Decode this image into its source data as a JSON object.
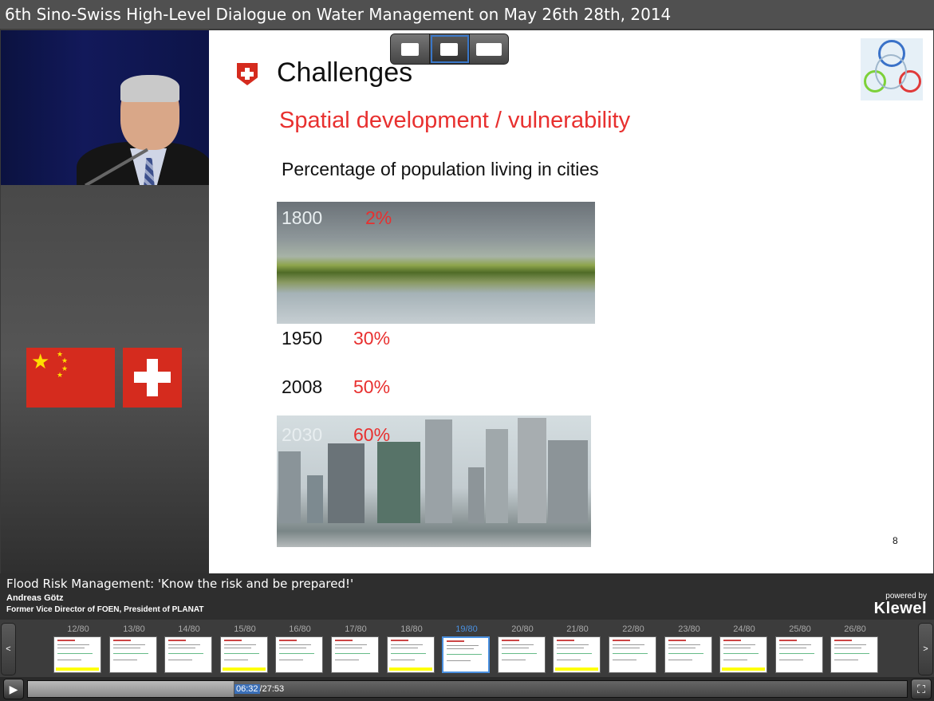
{
  "window": {
    "title": "6th Sino-Swiss High-Level Dialogue on Water Management on May 26th  28th, 2014"
  },
  "slide": {
    "title": "Challenges",
    "subtitle": "Spatial development / vulnerability",
    "heading": "Percentage of population living in cities",
    "rows": [
      {
        "year": "1800",
        "percent": "2%"
      },
      {
        "year": "1950",
        "percent": "30%"
      },
      {
        "year": "2008",
        "percent": "50%"
      },
      {
        "year": "2030",
        "percent": "60%"
      }
    ],
    "page_number": "8"
  },
  "talk": {
    "title": "Flood Risk Management: 'Know the risk and be prepared!'",
    "speaker": "Andreas Götz",
    "role": "Former Vice Director of FOEN, President of PLANAT"
  },
  "branding": {
    "powered_by": "powered by",
    "name": "Klewel"
  },
  "view_modes": [
    {
      "name": "video-only",
      "icon": "person-icon"
    },
    {
      "name": "slides-only",
      "icon": "slide-icon",
      "active": true
    },
    {
      "name": "video-and-slides",
      "icon": "person-slide-icon"
    }
  ],
  "thumbnails": {
    "prev_label": "<",
    "next_label": ">",
    "items": [
      {
        "label": "12/80"
      },
      {
        "label": "13/80"
      },
      {
        "label": "14/80"
      },
      {
        "label": "15/80"
      },
      {
        "label": "16/80"
      },
      {
        "label": "17/80"
      },
      {
        "label": "18/80"
      },
      {
        "label": "19/80",
        "current": true
      },
      {
        "label": "20/80"
      },
      {
        "label": "21/80"
      },
      {
        "label": "22/80"
      },
      {
        "label": "23/80"
      },
      {
        "label": "24/80"
      },
      {
        "label": "25/80"
      },
      {
        "label": "26/80"
      }
    ]
  },
  "player": {
    "current_time": "06:32",
    "duration": "/27:53",
    "progress": 0.2344,
    "play_icon": "play-icon",
    "fullscreen_icon": "fullscreen-icon"
  },
  "colors": {
    "accent_red": "#e8302f",
    "highlight_blue": "#4a90e0",
    "swiss_red": "#d52b1e"
  }
}
